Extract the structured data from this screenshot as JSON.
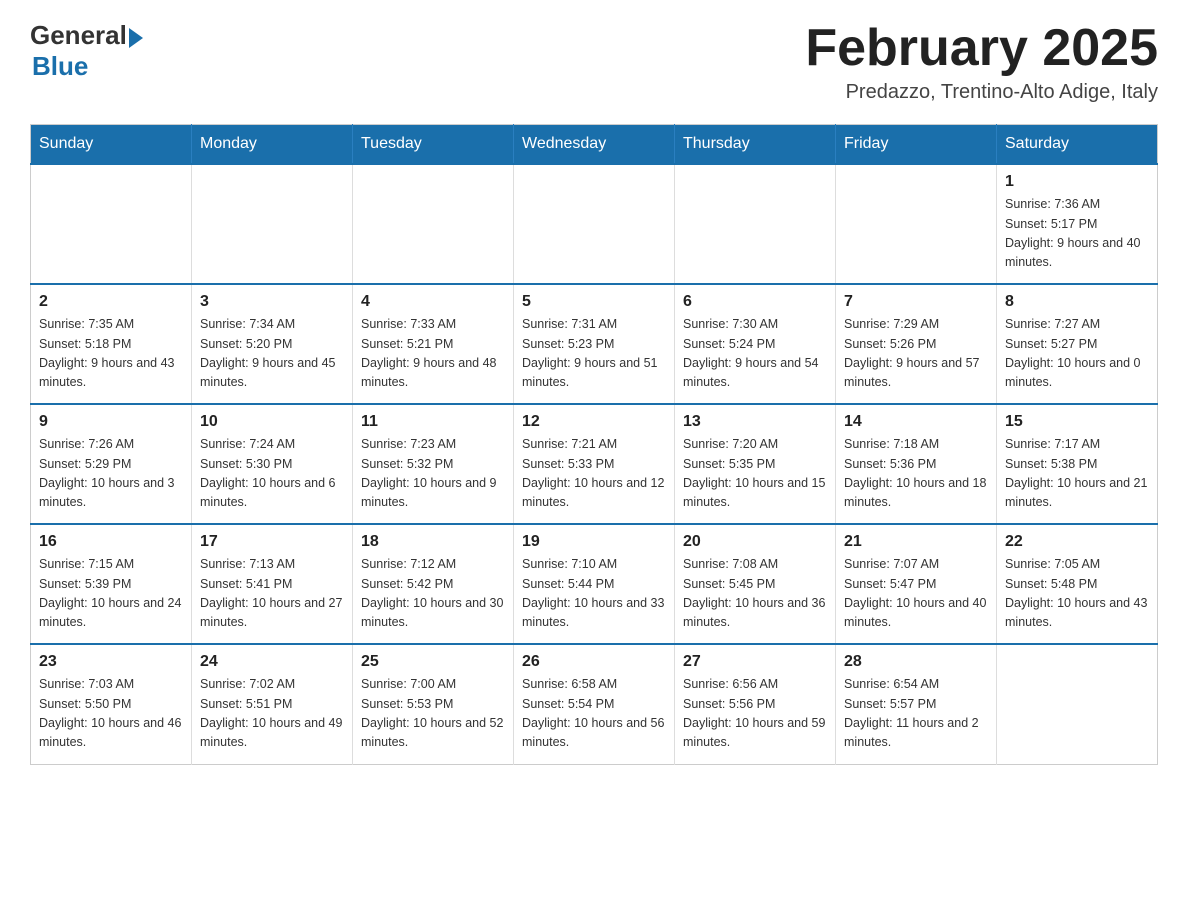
{
  "header": {
    "logo_general": "General",
    "logo_blue": "Blue",
    "month_title": "February 2025",
    "location": "Predazzo, Trentino-Alto Adige, Italy"
  },
  "days_of_week": [
    "Sunday",
    "Monday",
    "Tuesday",
    "Wednesday",
    "Thursday",
    "Friday",
    "Saturday"
  ],
  "weeks": [
    [
      {
        "day": "",
        "info": ""
      },
      {
        "day": "",
        "info": ""
      },
      {
        "day": "",
        "info": ""
      },
      {
        "day": "",
        "info": ""
      },
      {
        "day": "",
        "info": ""
      },
      {
        "day": "",
        "info": ""
      },
      {
        "day": "1",
        "info": "Sunrise: 7:36 AM\nSunset: 5:17 PM\nDaylight: 9 hours and 40 minutes."
      }
    ],
    [
      {
        "day": "2",
        "info": "Sunrise: 7:35 AM\nSunset: 5:18 PM\nDaylight: 9 hours and 43 minutes."
      },
      {
        "day": "3",
        "info": "Sunrise: 7:34 AM\nSunset: 5:20 PM\nDaylight: 9 hours and 45 minutes."
      },
      {
        "day": "4",
        "info": "Sunrise: 7:33 AM\nSunset: 5:21 PM\nDaylight: 9 hours and 48 minutes."
      },
      {
        "day": "5",
        "info": "Sunrise: 7:31 AM\nSunset: 5:23 PM\nDaylight: 9 hours and 51 minutes."
      },
      {
        "day": "6",
        "info": "Sunrise: 7:30 AM\nSunset: 5:24 PM\nDaylight: 9 hours and 54 minutes."
      },
      {
        "day": "7",
        "info": "Sunrise: 7:29 AM\nSunset: 5:26 PM\nDaylight: 9 hours and 57 minutes."
      },
      {
        "day": "8",
        "info": "Sunrise: 7:27 AM\nSunset: 5:27 PM\nDaylight: 10 hours and 0 minutes."
      }
    ],
    [
      {
        "day": "9",
        "info": "Sunrise: 7:26 AM\nSunset: 5:29 PM\nDaylight: 10 hours and 3 minutes."
      },
      {
        "day": "10",
        "info": "Sunrise: 7:24 AM\nSunset: 5:30 PM\nDaylight: 10 hours and 6 minutes."
      },
      {
        "day": "11",
        "info": "Sunrise: 7:23 AM\nSunset: 5:32 PM\nDaylight: 10 hours and 9 minutes."
      },
      {
        "day": "12",
        "info": "Sunrise: 7:21 AM\nSunset: 5:33 PM\nDaylight: 10 hours and 12 minutes."
      },
      {
        "day": "13",
        "info": "Sunrise: 7:20 AM\nSunset: 5:35 PM\nDaylight: 10 hours and 15 minutes."
      },
      {
        "day": "14",
        "info": "Sunrise: 7:18 AM\nSunset: 5:36 PM\nDaylight: 10 hours and 18 minutes."
      },
      {
        "day": "15",
        "info": "Sunrise: 7:17 AM\nSunset: 5:38 PM\nDaylight: 10 hours and 21 minutes."
      }
    ],
    [
      {
        "day": "16",
        "info": "Sunrise: 7:15 AM\nSunset: 5:39 PM\nDaylight: 10 hours and 24 minutes."
      },
      {
        "day": "17",
        "info": "Sunrise: 7:13 AM\nSunset: 5:41 PM\nDaylight: 10 hours and 27 minutes."
      },
      {
        "day": "18",
        "info": "Sunrise: 7:12 AM\nSunset: 5:42 PM\nDaylight: 10 hours and 30 minutes."
      },
      {
        "day": "19",
        "info": "Sunrise: 7:10 AM\nSunset: 5:44 PM\nDaylight: 10 hours and 33 minutes."
      },
      {
        "day": "20",
        "info": "Sunrise: 7:08 AM\nSunset: 5:45 PM\nDaylight: 10 hours and 36 minutes."
      },
      {
        "day": "21",
        "info": "Sunrise: 7:07 AM\nSunset: 5:47 PM\nDaylight: 10 hours and 40 minutes."
      },
      {
        "day": "22",
        "info": "Sunrise: 7:05 AM\nSunset: 5:48 PM\nDaylight: 10 hours and 43 minutes."
      }
    ],
    [
      {
        "day": "23",
        "info": "Sunrise: 7:03 AM\nSunset: 5:50 PM\nDaylight: 10 hours and 46 minutes."
      },
      {
        "day": "24",
        "info": "Sunrise: 7:02 AM\nSunset: 5:51 PM\nDaylight: 10 hours and 49 minutes."
      },
      {
        "day": "25",
        "info": "Sunrise: 7:00 AM\nSunset: 5:53 PM\nDaylight: 10 hours and 52 minutes."
      },
      {
        "day": "26",
        "info": "Sunrise: 6:58 AM\nSunset: 5:54 PM\nDaylight: 10 hours and 56 minutes."
      },
      {
        "day": "27",
        "info": "Sunrise: 6:56 AM\nSunset: 5:56 PM\nDaylight: 10 hours and 59 minutes."
      },
      {
        "day": "28",
        "info": "Sunrise: 6:54 AM\nSunset: 5:57 PM\nDaylight: 11 hours and 2 minutes."
      },
      {
        "day": "",
        "info": ""
      }
    ]
  ],
  "accent_color": "#1a6fab"
}
